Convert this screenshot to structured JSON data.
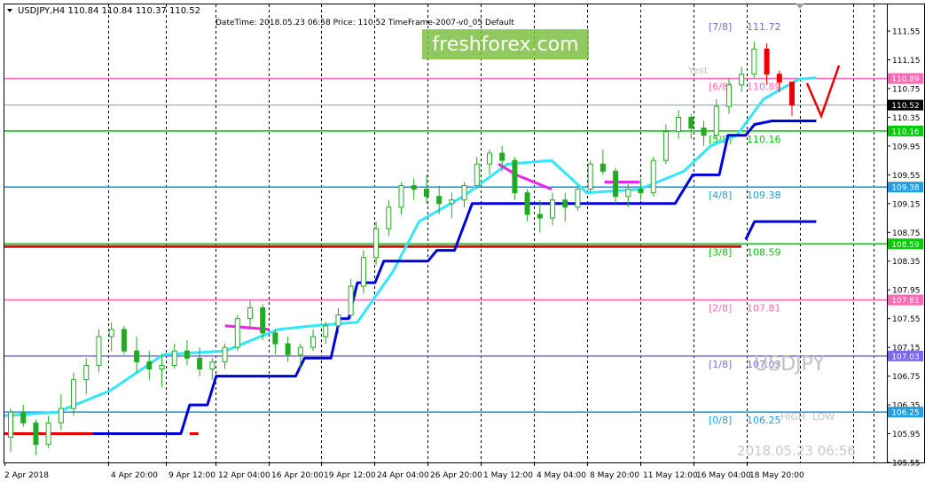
{
  "header": {
    "symbol_line": "USDJPY,H4  110.84 110.84 110.37 110.52",
    "indicator_line": "DateTime: 2018.05.23 06:58   Price: 110.52   TimeFrame-2007-v0_05   Default"
  },
  "watermarks": {
    "brand": "freshforex.com",
    "symbol": "USDJPY",
    "timestamp": "2018.05.23 06:56",
    "yesterday": "Yest",
    "high": "HIGH",
    "low": "LOW"
  },
  "colors": {
    "frame": "#000000",
    "grid": "#000000",
    "candle": "#22aa22",
    "cyan_line": "#33e6ff",
    "magenta_line": "#ee22ee",
    "blue_line": "#0000dd",
    "red_line": "#ee0000",
    "checkmark": "#ee0000",
    "current_price_line": "#8899aa"
  },
  "chart_data": {
    "type": "line",
    "symbol": "USDJPY",
    "timeframe": "H4",
    "ylim": [
      105.55,
      111.92
    ],
    "y_ticks": [
      "111.55",
      "111.15",
      "110.75",
      "110.35",
      "109.95",
      "109.55",
      "109.15",
      "108.75",
      "108.35",
      "107.95",
      "107.55",
      "107.15",
      "106.75",
      "106.35",
      "105.95",
      "105.55"
    ],
    "x_ticks": [
      "2 Apr 2018",
      "4 Apr 20:00",
      "9 Apr 12:00",
      "12 Apr 04:00",
      "16 Apr 20:00",
      "19 Apr 12:00",
      "24 Apr 04:00",
      "26 Apr 20:00",
      "1 May 12:00",
      "4 May 04:00",
      "8 May 20:00",
      "11 May 12:00",
      "16 May 04:00",
      "18 May 20:00"
    ],
    "ohlc": {
      "open": 110.84,
      "high": 110.84,
      "low": 110.37,
      "close": 110.52
    },
    "murrey_levels": [
      {
        "label": "[7/8]",
        "value": 111.72,
        "text": "111.72",
        "color": "#7b68ee"
      },
      {
        "label": "[6/8]",
        "value": 110.89,
        "text": "110.89",
        "color": "#ff69b4",
        "price_box": "110.89"
      },
      {
        "label": "[5/8]",
        "value": 110.16,
        "text": "110.16",
        "color": "#00cc00",
        "price_box": "110.16"
      },
      {
        "label": "[4/8]",
        "value": 109.38,
        "text": "109.38",
        "color": "#1ea0e6",
        "price_box": "109.38"
      },
      {
        "label": "[3/8]",
        "value": 108.59,
        "text": "108.59",
        "color": "#00cc00",
        "price_box": "108.59"
      },
      {
        "label": "[2/8]",
        "value": 107.81,
        "text": "107.81",
        "color": "#ff69b4",
        "price_box": "107.81"
      },
      {
        "label": "[1/8]",
        "value": 107.03,
        "text": "107.03",
        "color": "#7b68ee",
        "price_box": "107.03"
      },
      {
        "label": "[0/8]",
        "value": 106.25,
        "text": "106.25",
        "color": "#1ea0e6",
        "price_box": "106.25"
      }
    ],
    "current_price": {
      "value": 110.52,
      "text": "110.52"
    },
    "candles": [
      [
        105.9,
        106.3,
        105.7,
        106.25
      ],
      [
        106.25,
        106.35,
        106.05,
        106.1
      ],
      [
        106.1,
        106.15,
        105.65,
        105.8
      ],
      [
        105.8,
        106.2,
        105.75,
        106.1
      ],
      [
        106.1,
        106.5,
        106.0,
        106.3
      ],
      [
        106.3,
        106.8,
        106.2,
        106.7
      ],
      [
        106.7,
        107.0,
        106.5,
        106.9
      ],
      [
        106.9,
        107.4,
        106.8,
        107.3
      ],
      [
        107.3,
        107.5,
        107.1,
        107.4
      ],
      [
        107.4,
        107.45,
        107.05,
        107.1
      ],
      [
        107.1,
        107.3,
        106.8,
        106.95
      ],
      [
        106.95,
        107.1,
        106.7,
        106.85
      ],
      [
        106.85,
        107.05,
        106.6,
        106.9
      ],
      [
        106.9,
        107.2,
        106.85,
        107.1
      ],
      [
        107.1,
        107.25,
        106.9,
        107.0
      ],
      [
        107.0,
        107.15,
        106.75,
        106.85
      ],
      [
        106.85,
        107.0,
        106.7,
        106.95
      ],
      [
        106.95,
        107.2,
        106.85,
        107.15
      ],
      [
        107.15,
        107.6,
        107.1,
        107.55
      ],
      [
        107.55,
        107.8,
        107.4,
        107.7
      ],
      [
        107.7,
        107.75,
        107.25,
        107.35
      ],
      [
        107.35,
        107.4,
        107.05,
        107.2
      ],
      [
        107.2,
        107.3,
        106.95,
        107.05
      ],
      [
        107.05,
        107.2,
        106.85,
        107.15
      ],
      [
        107.15,
        107.4,
        107.1,
        107.3
      ],
      [
        107.3,
        107.5,
        107.2,
        107.45
      ],
      [
        107.45,
        107.7,
        107.35,
        107.6
      ],
      [
        107.6,
        108.1,
        107.55,
        108.0
      ],
      [
        108.0,
        108.5,
        107.9,
        108.4
      ],
      [
        108.4,
        108.9,
        108.3,
        108.8
      ],
      [
        108.8,
        109.2,
        108.7,
        109.1
      ],
      [
        109.1,
        109.45,
        109.0,
        109.4
      ],
      [
        109.4,
        109.5,
        109.2,
        109.35
      ],
      [
        109.35,
        109.55,
        109.15,
        109.25
      ],
      [
        109.25,
        109.4,
        109.0,
        109.15
      ],
      [
        109.15,
        109.3,
        108.95,
        109.2
      ],
      [
        109.2,
        109.45,
        109.1,
        109.4
      ],
      [
        109.4,
        109.8,
        109.35,
        109.7
      ],
      [
        109.7,
        109.9,
        109.55,
        109.85
      ],
      [
        109.85,
        109.95,
        109.6,
        109.75
      ],
      [
        109.75,
        109.8,
        109.2,
        109.3
      ],
      [
        109.3,
        109.35,
        108.9,
        109.0
      ],
      [
        109.0,
        109.2,
        108.75,
        108.95
      ],
      [
        108.95,
        109.3,
        108.85,
        109.2
      ],
      [
        109.2,
        109.3,
        108.9,
        109.1
      ],
      [
        109.1,
        109.4,
        109.05,
        109.35
      ],
      [
        109.35,
        109.75,
        109.3,
        109.7
      ],
      [
        109.7,
        109.9,
        109.55,
        109.6
      ],
      [
        109.6,
        109.65,
        109.15,
        109.25
      ],
      [
        109.25,
        109.45,
        109.1,
        109.35
      ],
      [
        109.35,
        109.5,
        109.2,
        109.3
      ],
      [
        109.3,
        109.8,
        109.25,
        109.75
      ],
      [
        109.75,
        110.25,
        109.7,
        110.15
      ],
      [
        110.15,
        110.45,
        110.05,
        110.35
      ],
      [
        110.35,
        110.4,
        110.05,
        110.2
      ],
      [
        110.2,
        110.3,
        109.95,
        110.1
      ],
      [
        110.1,
        110.6,
        110.05,
        110.5
      ],
      [
        110.5,
        110.9,
        110.4,
        110.8
      ],
      [
        110.8,
        111.05,
        110.7,
        110.95
      ],
      [
        110.95,
        111.4,
        110.9,
        111.3
      ],
      [
        111.3,
        111.38,
        110.8,
        110.95
      ],
      [
        110.95,
        111.0,
        110.7,
        110.84
      ],
      [
        110.84,
        110.84,
        110.37,
        110.52
      ]
    ],
    "series": [
      {
        "name": "",
        "color": "#33e6ff",
        "points": [
          [
            0.0,
            106.2
          ],
          [
            0.06,
            106.25
          ],
          [
            0.12,
            106.55
          ],
          [
            0.18,
            107.05
          ],
          [
            0.25,
            107.1
          ],
          [
            0.31,
            107.4
          ],
          [
            0.35,
            107.45
          ],
          [
            0.4,
            107.5
          ],
          [
            0.44,
            108.2
          ],
          [
            0.47,
            108.9
          ],
          [
            0.52,
            109.25
          ],
          [
            0.57,
            109.7
          ],
          [
            0.62,
            109.75
          ],
          [
            0.66,
            109.3
          ],
          [
            0.72,
            109.35
          ],
          [
            0.77,
            109.6
          ],
          [
            0.8,
            109.95
          ],
          [
            0.83,
            110.1
          ],
          [
            0.86,
            110.6
          ],
          [
            0.9,
            110.88
          ],
          [
            0.92,
            110.9
          ]
        ]
      },
      {
        "name": "",
        "color": "#ee22ee",
        "segments": [
          [
            [
              0.25,
              107.45
            ],
            [
              0.3,
              107.4
            ]
          ],
          [
            [
              0.56,
              109.7
            ],
            [
              0.58,
              109.55
            ],
            [
              0.62,
              109.35
            ]
          ],
          [
            [
              0.68,
              109.45
            ],
            [
              0.72,
              109.45
            ]
          ]
        ]
      },
      {
        "name": "",
        "color": "#0000dd",
        "points": [
          [
            0.1,
            105.95
          ],
          [
            0.2,
            105.95
          ],
          [
            0.21,
            106.35
          ],
          [
            0.23,
            106.35
          ],
          [
            0.24,
            106.75
          ],
          [
            0.33,
            106.75
          ],
          [
            0.34,
            107.0
          ],
          [
            0.37,
            107.0
          ],
          [
            0.38,
            107.55
          ],
          [
            0.39,
            107.55
          ],
          [
            0.4,
            108.05
          ],
          [
            0.42,
            108.05
          ],
          [
            0.43,
            108.35
          ],
          [
            0.48,
            108.35
          ],
          [
            0.49,
            108.5
          ],
          [
            0.51,
            108.5
          ],
          [
            0.53,
            109.15
          ],
          [
            0.76,
            109.15
          ],
          [
            0.78,
            109.55
          ],
          [
            0.81,
            109.55
          ],
          [
            0.82,
            110.1
          ],
          [
            0.84,
            110.1
          ],
          [
            0.85,
            110.25
          ],
          [
            0.87,
            110.3
          ],
          [
            0.92,
            110.3
          ]
        ]
      },
      {
        "name": "",
        "color": "#0000dd",
        "points": [
          [
            0.84,
            108.65
          ],
          [
            0.85,
            108.9
          ],
          [
            0.92,
            108.9
          ]
        ]
      },
      {
        "name": "",
        "color": "#ee0000",
        "points": [
          [
            0.0,
            105.95
          ],
          [
            0.1,
            105.95
          ]
        ]
      },
      {
        "name": "",
        "color": "#ee0000",
        "points": [
          [
            0.21,
            105.95
          ],
          [
            0.22,
            105.95
          ]
        ]
      }
    ]
  }
}
